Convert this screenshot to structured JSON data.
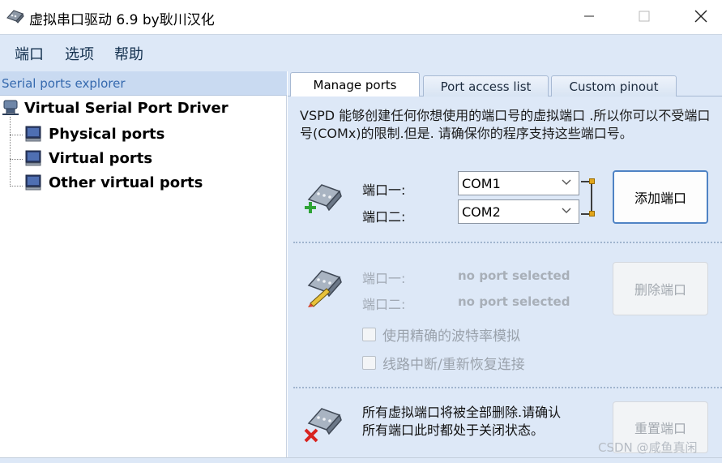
{
  "window": {
    "title": "虚拟串口驱动 6.9 by耿川汉化"
  },
  "menu": [
    "端口",
    "选项",
    "帮助"
  ],
  "explorer": {
    "header": "Serial ports explorer",
    "root": "Virtual Serial Port Driver",
    "children": [
      "Physical ports",
      "Virtual ports",
      "Other virtual ports"
    ]
  },
  "tabs": [
    "Manage ports",
    "Port access list",
    "Custom pinout"
  ],
  "manage": {
    "description": "VSPD 能够创建任何你想使用的端口号的虚拟端口 .所以你可以不受端口号(COMx)的限制.但是. 请确保你的程序支持这些端口号。",
    "add": {
      "port1_label": "端口一:",
      "port2_label": "端口二:",
      "port1_value": "COM1",
      "port2_value": "COM2",
      "button": "添加端口"
    },
    "remove": {
      "port1_label": "端口一:",
      "port2_label": "端口二:",
      "port1_value": "no port selected",
      "port2_value": "no port selected",
      "button": "删除端口",
      "option1": "使用精确的波特率模拟",
      "option2": "线路中断/重新恢复连接"
    },
    "reset": {
      "note": "所有虚拟端口将被全部删除.请确认所有端口此时都处于关闭状态。",
      "button": "重置端口"
    }
  },
  "watermark": "CSDN @咸鱼真闲"
}
